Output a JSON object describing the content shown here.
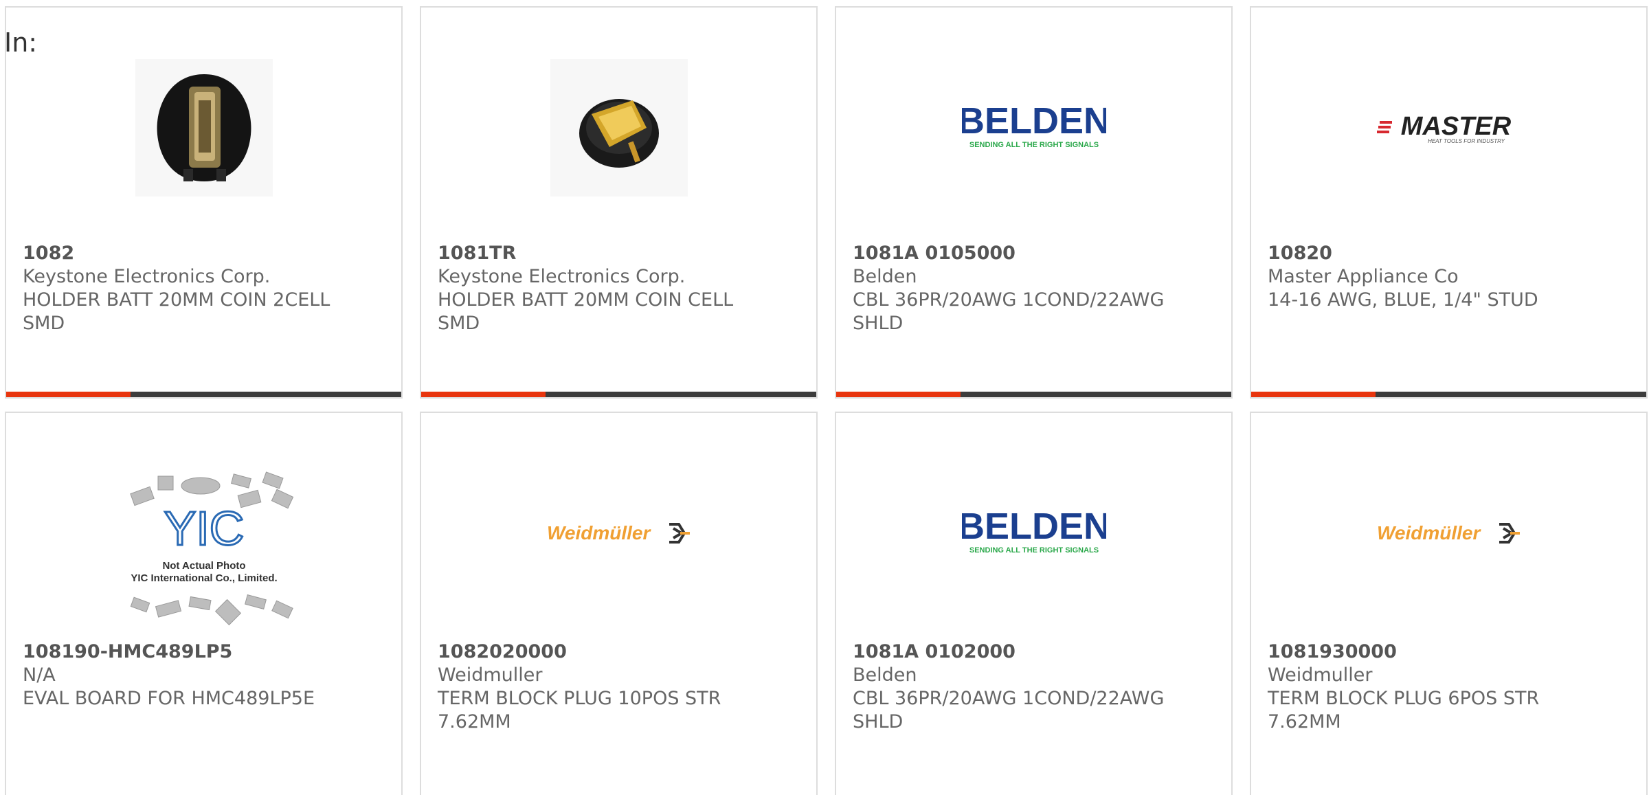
{
  "heading": "In:",
  "colors": {
    "accent": "#e8350e",
    "bar_track": "#3c3c3c",
    "border": "#dddddd",
    "text": "#666666"
  },
  "products": [
    {
      "part": "1082",
      "manufacturer": "Keystone Electronics Corp.",
      "description": "HOLDER BATT 20MM COIN 2CELL SMD",
      "image": "battery-holder-2cell-icon",
      "progress": 0.315
    },
    {
      "part": "1081TR",
      "manufacturer": "Keystone Electronics Corp.",
      "description": "HOLDER BATT 20MM COIN CELL SMD",
      "image": "battery-holder-coin-icon",
      "progress": 0.315
    },
    {
      "part": "1081A 0105000",
      "manufacturer": "Belden",
      "description": "CBL 36PR/20AWG 1COND/22AWG SHLD",
      "image": "belden-logo",
      "logo_text": "BELDEN",
      "logo_tagline": "SENDING ALL THE RIGHT SIGNALS",
      "progress": 0.315
    },
    {
      "part": "10820",
      "manufacturer": "Master Appliance Co",
      "description": "14-16 AWG, BLUE, 1/4\" STUD",
      "image": "master-logo",
      "logo_text": "MASTER",
      "logo_tagline": "HEAT TOOLS FOR INDUSTRY",
      "progress": 0.315
    },
    {
      "part": "108190-HMC489LP5",
      "manufacturer": "N/A",
      "description": "EVAL BOARD FOR HMC489LP5E",
      "image": "yic-placeholder",
      "logo_text": "YIC",
      "photo_note": "Not Actual Photo",
      "photo_company": "YIC International Co., Limited."
    },
    {
      "part": "1082020000",
      "manufacturer": "Weidmuller",
      "description": "TERM BLOCK PLUG 10POS STR 7.62MM",
      "image": "weidmuller-logo",
      "logo_text": "Weidmüller"
    },
    {
      "part": "1081A 0102000",
      "manufacturer": "Belden",
      "description": "CBL 36PR/20AWG 1COND/22AWG SHLD",
      "image": "belden-logo",
      "logo_text": "BELDEN",
      "logo_tagline": "SENDING ALL THE RIGHT SIGNALS"
    },
    {
      "part": "1081930000",
      "manufacturer": "Weidmuller",
      "description": "TERM BLOCK PLUG 6POS STR 7.62MM",
      "image": "weidmuller-logo",
      "logo_text": "Weidmüller"
    }
  ]
}
